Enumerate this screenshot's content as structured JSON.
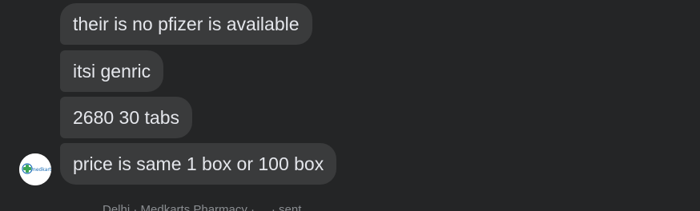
{
  "messages": [
    {
      "text": "their is no pfizer is available"
    },
    {
      "text": "itsi genric"
    },
    {
      "text": "2680 30 tabs"
    },
    {
      "text": "price is same 1 box or 100 box"
    }
  ],
  "avatar": {
    "logo_text": "medkarts",
    "alt": "sender avatar"
  },
  "footer": {
    "text": "Delhi · Medkarts Pharmacy · ... · sent"
  },
  "colors": {
    "background": "#242526",
    "bubble": "#3a3b3c",
    "text": "#e4e6eb",
    "logo_green": "#3aa655",
    "logo_blue": "#1e6fb8"
  }
}
